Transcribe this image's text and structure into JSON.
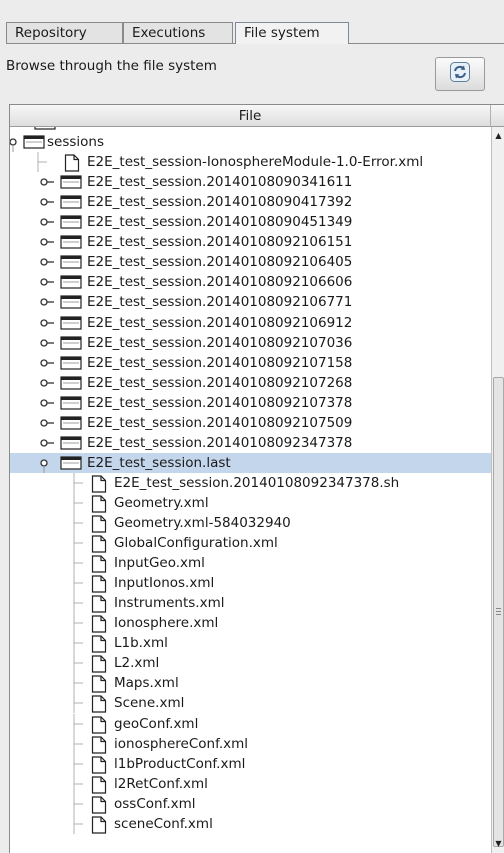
{
  "tabs": [
    {
      "label": "Repository",
      "active": false
    },
    {
      "label": "Executions",
      "active": false
    },
    {
      "label": "File system",
      "active": true
    }
  ],
  "description": "Browse through the file system",
  "refresh_icon": "refresh-icon",
  "tree": {
    "column_header": "File",
    "root": {
      "label": "sessions",
      "icon": "folder-icon",
      "expanded": true
    },
    "session_error_file": "E2E_test_session-IonosphereModule-1.0-Error.xml",
    "sessions": [
      "E2E_test_session.20140108090341611",
      "E2E_test_session.20140108090417392",
      "E2E_test_session.20140108090451349",
      "E2E_test_session.20140108092106151",
      "E2E_test_session.20140108092106405",
      "E2E_test_session.20140108092106606",
      "E2E_test_session.20140108092106771",
      "E2E_test_session.20140108092106912",
      "E2E_test_session.20140108092107036",
      "E2E_test_session.20140108092107158",
      "E2E_test_session.20140108092107268",
      "E2E_test_session.20140108092107378",
      "E2E_test_session.20140108092107509",
      "E2E_test_session.20140108092347378"
    ],
    "selected_folder": "E2E_test_session.last",
    "last_files": [
      "E2E_test_session.20140108092347378.sh",
      "Geometry.xml",
      "Geometry.xml-584032940",
      "GlobalConfiguration.xml",
      "InputGeo.xml",
      "InputIonos.xml",
      "Instruments.xml",
      "Ionosphere.xml",
      "L1b.xml",
      "L2.xml",
      "Maps.xml",
      "Scene.xml",
      "geoConf.xml",
      "ionosphereConf.xml",
      "l1bProductConf.xml",
      "l2RetConf.xml",
      "ossConf.xml",
      "sceneConf.xml"
    ]
  },
  "colors": {
    "selection": "#c4d6ec",
    "panel_bg": "#ffffff",
    "window_bg": "#ececec"
  }
}
